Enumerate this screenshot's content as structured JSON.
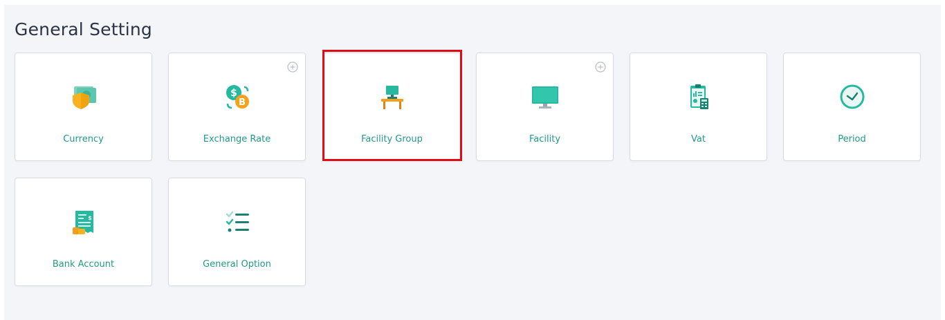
{
  "page": {
    "title": "General Setting"
  },
  "cards": [
    {
      "label": "Currency",
      "icon": "currency-shield-icon",
      "has_add": false
    },
    {
      "label": "Exchange Rate",
      "icon": "dollar-bitcoin-exchange-icon",
      "has_add": true
    },
    {
      "label": "Facility Group",
      "icon": "desk-computer-icon",
      "has_add": false,
      "highlighted": true
    },
    {
      "label": "Facility",
      "icon": "monitor-icon",
      "has_add": true
    },
    {
      "label": "Vat",
      "icon": "report-calculator-icon",
      "has_add": false
    },
    {
      "label": "Period",
      "icon": "clock-icon",
      "has_add": false
    },
    {
      "label": "Bank Account",
      "icon": "bank-statement-icon",
      "has_add": false
    },
    {
      "label": "General Option",
      "icon": "checklist-icon",
      "has_add": false
    }
  ],
  "colors": {
    "accent": "#1f9b86",
    "teal_icon": "#25b9a0",
    "highlight": "#e30b13",
    "orange": "#f59e1b"
  }
}
